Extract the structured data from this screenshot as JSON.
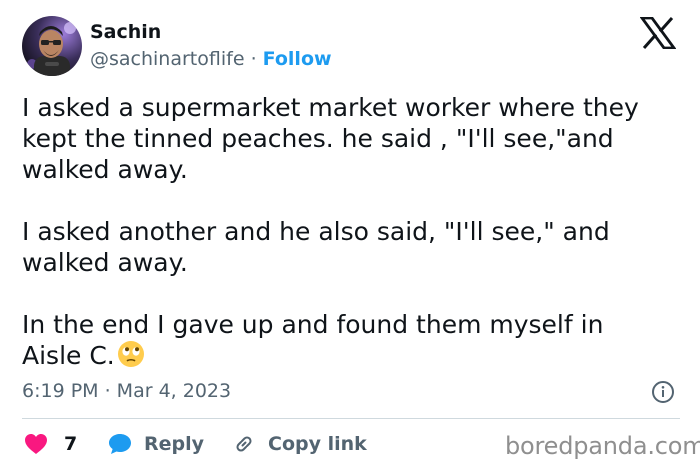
{
  "tweet": {
    "author": {
      "name": "Sachin",
      "handle": "@sachinartoflife",
      "separator": "·",
      "follow_label": "Follow"
    },
    "text": {
      "line1": "I asked a supermarket market worker where they",
      "line2": "kept the tinned peaches. he said , \"I'll see,\"and",
      "line3": "walked away.",
      "line4": "I asked another and he also said, \"I'll see,\" and",
      "line5": "walked away.",
      "line6": "In the end I gave up and found them myself in",
      "line7": "Aisle C."
    },
    "timestamp": "6:19 PM · Mar 4, 2023",
    "actions": {
      "like_count": "7",
      "reply_label": "Reply",
      "copy_label": "Copy link"
    },
    "colors": {
      "like": "#f91880",
      "link": "#1d9bf0",
      "secondary_text": "#536471",
      "divider": "#cfd9de"
    },
    "icons": [
      "x-logo-icon",
      "info-icon",
      "heart-icon",
      "reply-bubble-icon",
      "link-icon",
      "eye-roll-emoji-icon"
    ]
  },
  "watermark": "boredpanda.com"
}
